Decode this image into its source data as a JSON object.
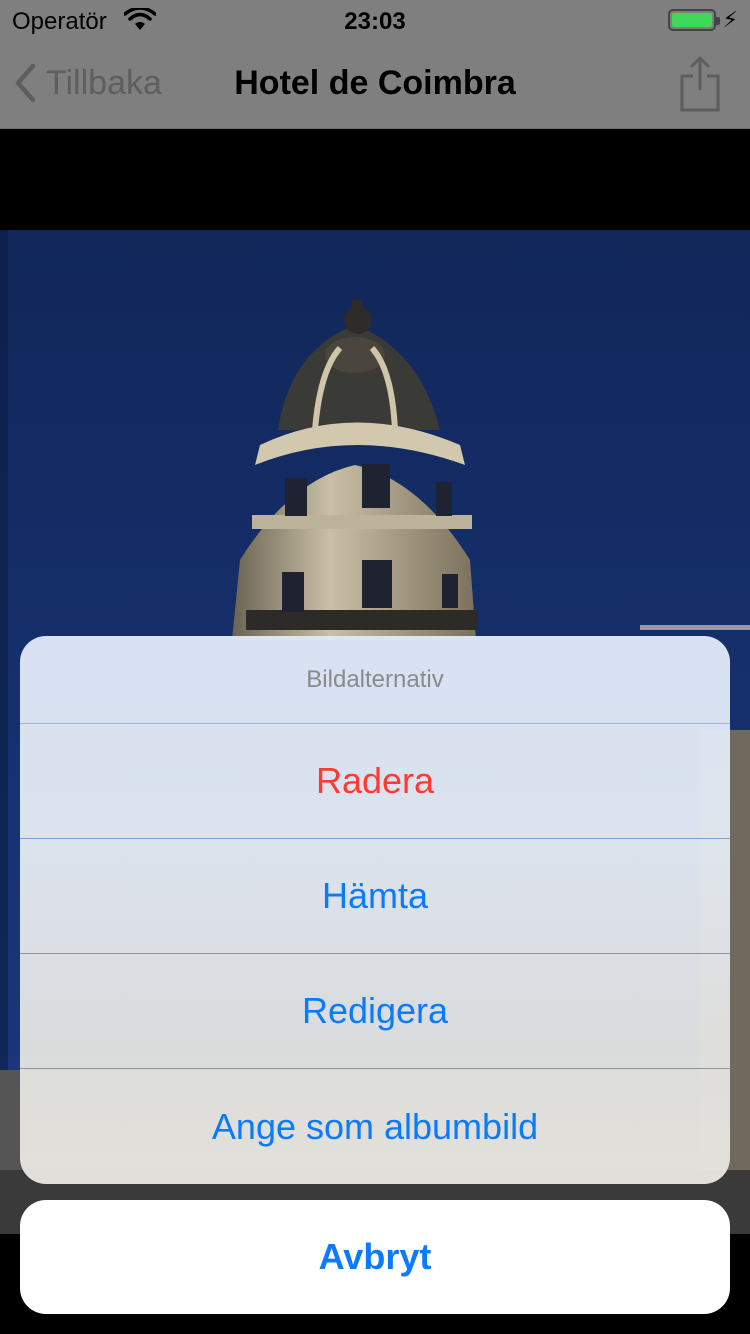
{
  "status": {
    "carrier": "Operatör",
    "time": "23:03",
    "battery_color": "#3fd85a"
  },
  "nav": {
    "back_label": "Tillbaka",
    "title": "Hotel de Coimbra",
    "share_icon": "share-icon"
  },
  "action_sheet": {
    "title": "Bildalternativ",
    "actions": [
      {
        "label": "Radera",
        "style": "destructive"
      },
      {
        "label": "Hämta",
        "style": "default"
      },
      {
        "label": "Redigera",
        "style": "default"
      },
      {
        "label": "Ange som albumbild",
        "style": "default"
      }
    ],
    "cancel_label": "Avbryt"
  },
  "colors": {
    "accent": "#0a7aff",
    "destructive": "#ff3b30"
  }
}
